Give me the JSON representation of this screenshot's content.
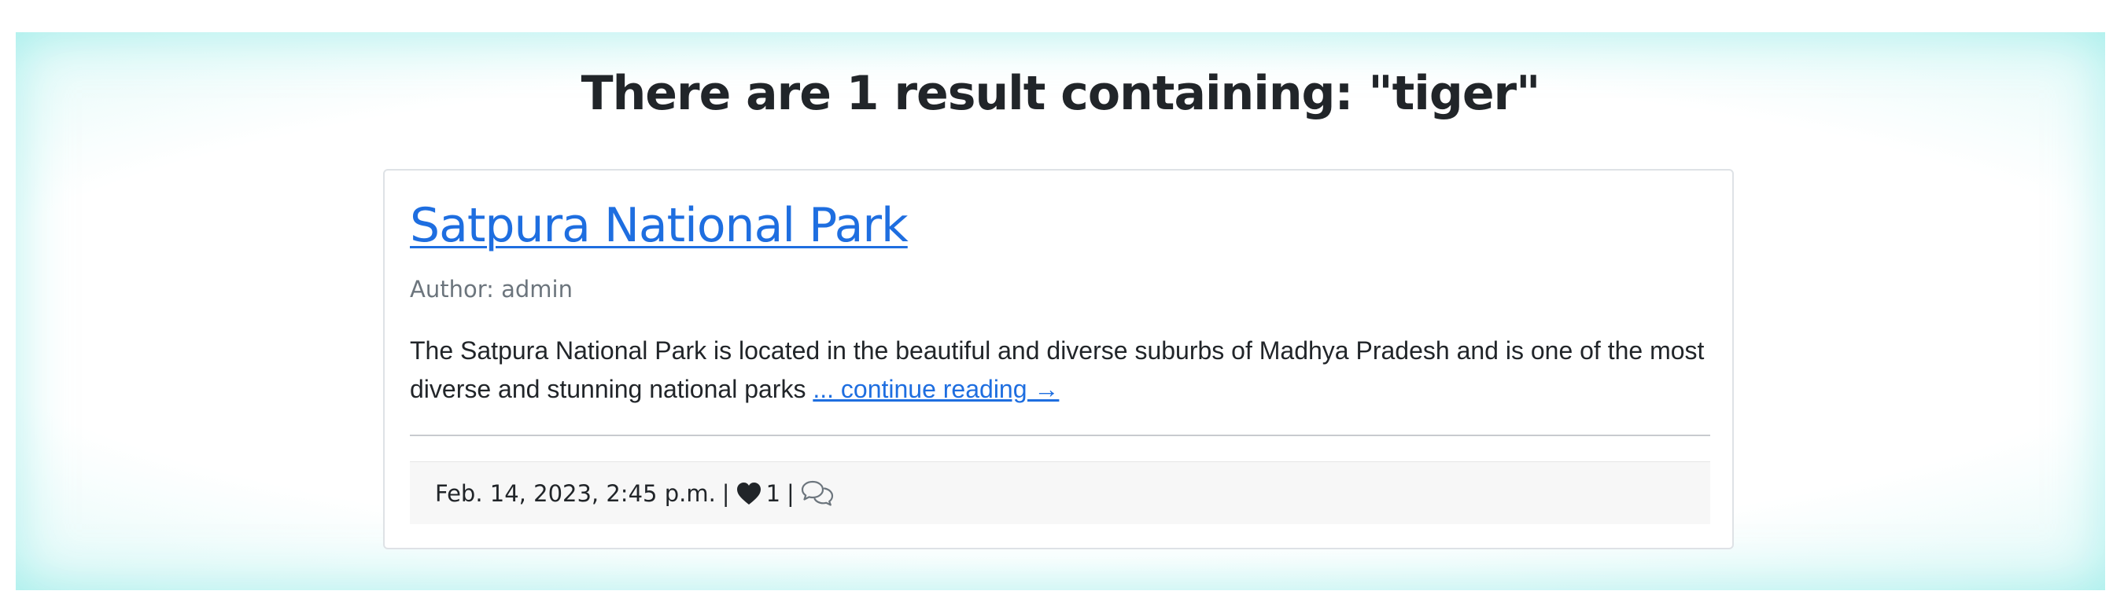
{
  "search": {
    "heading": "There are 1 result containing: \"tiger\""
  },
  "results": [
    {
      "title": "Satpura National Park",
      "author": "Author: admin",
      "excerpt": "The Satpura National Park is located in the beautiful and diverse suburbs of Madhya Pradesh and is one of the most diverse and stunning national parks",
      "continue_link": "... continue reading →",
      "date": "Feb. 14, 2023, 2:45 p.m.",
      "separator": "|",
      "like_count": "1",
      "icons": {
        "like": "heart-icon",
        "comment": "comments-icon"
      }
    }
  ],
  "colors": {
    "link": "#1e6ee0",
    "section_glow": "#b5f0ec",
    "footer_bg": "#f7f7f7"
  }
}
